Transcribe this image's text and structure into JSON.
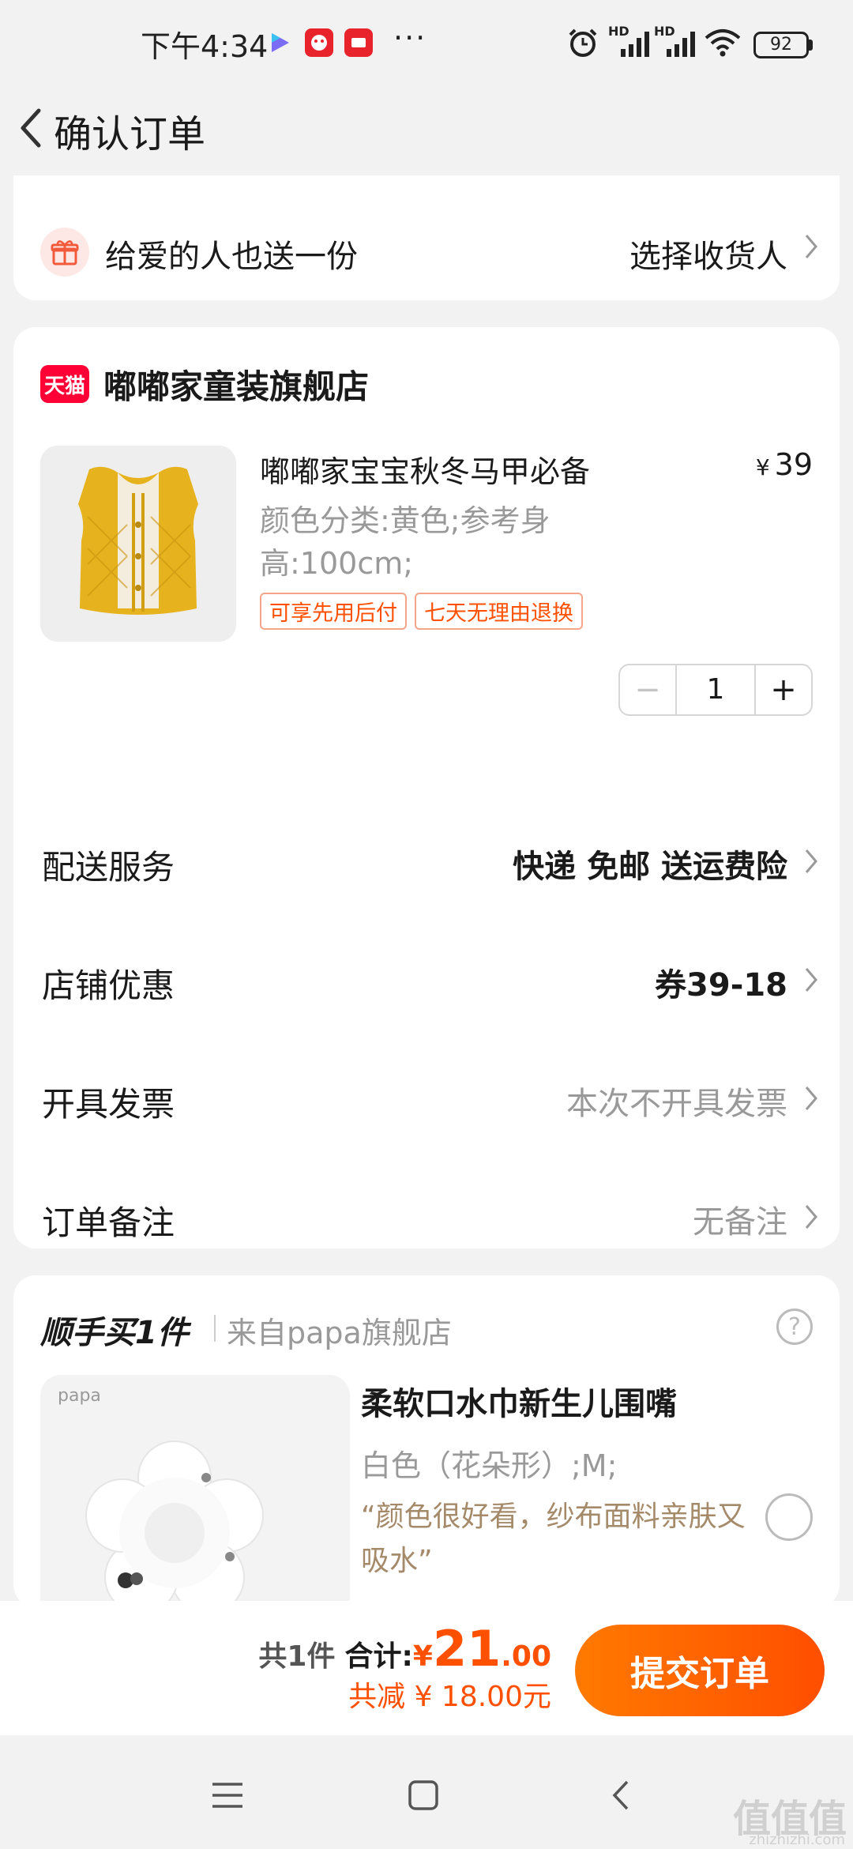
{
  "status_bar": {
    "time": "下午4:34",
    "more": "···",
    "battery": "92",
    "network_label": "HD"
  },
  "header": {
    "title": "确认订单"
  },
  "gift": {
    "text": "给爱的人也送一份",
    "action": "选择收货人"
  },
  "shop": {
    "badge": "天猫",
    "name": "嘟嘟家童装旗舰店"
  },
  "product": {
    "title": "嘟嘟家宝宝秋冬马甲必备",
    "currency": "¥",
    "price": "39",
    "spec": "颜色分类:黄色;参考身高:100cm;",
    "tags": [
      "可享先用后付",
      "七天无理由退换"
    ],
    "quantity": "1",
    "minus": "−",
    "plus": "+",
    "image_color": "#e6b31e"
  },
  "rows": {
    "delivery": {
      "label": "配送服务",
      "value": "快递 免邮 送运费险"
    },
    "coupon": {
      "label": "店铺优惠",
      "value": "券39-18"
    },
    "invoice": {
      "label": "开具发票",
      "value": "本次不开具发票"
    },
    "note": {
      "label": "订单备注",
      "value": "无备注"
    }
  },
  "addon": {
    "title": "顺手买1件",
    "from": "来自papa旗舰店",
    "help": "?",
    "brand": "papa",
    "name": "柔软口水巾新生儿围嘴",
    "spec": "白色（花朵形）;M;",
    "review": "“颜色很好看，纱布面料亲肤又吸水”"
  },
  "summary": {
    "count": "共1件",
    "total_label": "合计:",
    "currency": "¥",
    "total_int": "21",
    "total_dec": ".00",
    "saving": "共减 ¥ 18.00元",
    "submit": "提交订单"
  },
  "watermark": {
    "main": "值值值",
    "sub": "zhizhizhi.com"
  },
  "colors": {
    "accent": "#ff5000",
    "tmall": "#ff0036",
    "background": "#f2f2f2"
  }
}
